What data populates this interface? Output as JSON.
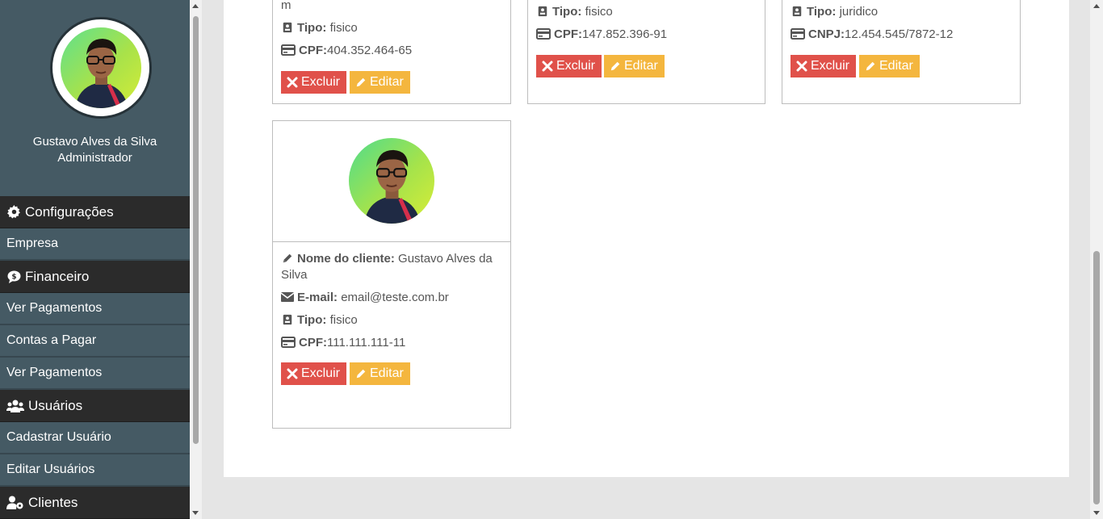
{
  "sidebar": {
    "profile": {
      "name": "Gustavo Alves da Silva",
      "role": "Administrador"
    },
    "sections": [
      {
        "label": "Configurações",
        "icon": "gear-icon",
        "items": [
          "Empresa"
        ]
      },
      {
        "label": "Financeiro",
        "icon": "money-bubble-icon",
        "items": [
          "Ver Pagamentos",
          "Contas a Pagar",
          "Ver Pagamentos"
        ]
      },
      {
        "label": "Usuários",
        "icon": "users-icon",
        "items": [
          "Cadastrar Usuário",
          "Editar Usuários"
        ]
      },
      {
        "label": "Clientes",
        "icon": "user-gear-icon",
        "items": []
      }
    ]
  },
  "labels": {
    "nome": "Nome do cliente:",
    "email": "E-mail:",
    "tipo": "Tipo:",
    "cpf": "CPF:",
    "cnpj": "CNPJ:",
    "excluir": "Excluir",
    "editar": "Editar"
  },
  "cards": [
    {
      "name_tail": "m",
      "tipo": "fisico",
      "doc_label": "CPF:",
      "doc": "404.352.464-65"
    },
    {
      "tipo": "fisico",
      "doc_label": "CPF:",
      "doc": "147.852.396-91"
    },
    {
      "tipo": "juridico",
      "doc_label": "CNPJ:",
      "doc": "12.454.545/7872-12"
    },
    {
      "name": "Gustavo Alves da Silva",
      "email": "email@teste.com.br",
      "tipo": "fisico",
      "doc_label": "CPF:",
      "doc": "111.111.111-11"
    }
  ],
  "colors": {
    "sidebar_bg": "#455a64",
    "menu_head_bg": "#2b2b2b",
    "delete": "#e0514a",
    "edit": "#f4b63e"
  }
}
